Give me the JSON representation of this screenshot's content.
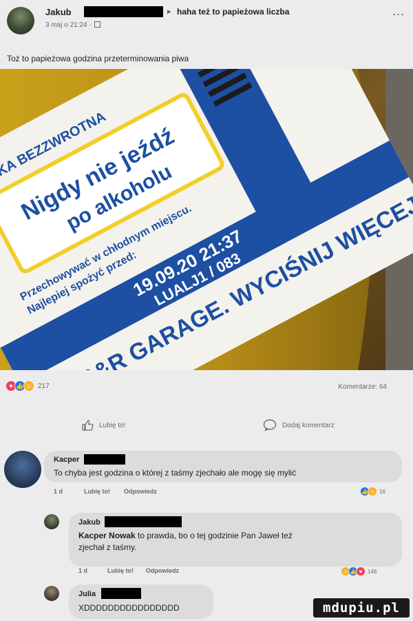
{
  "post": {
    "author": "Jakub",
    "arrow": "▸",
    "group": "haha też to papieżowa liczba",
    "more": "...",
    "date": "3 maj o 21:24 ·",
    "text": "Toż to papieżowa godzina przeterminowania piwa"
  },
  "photo": {
    "label_line1": "Nigdy nie jeźdź",
    "label_line2": "po alkoholu",
    "label_top": "ELKA BEZZWROTNA",
    "store_line1": "Przechowywać w chłodnym miejscu.",
    "store_line2": "Najlepiej spożyć przed:",
    "date_line1": "19.09.20  21:37",
    "date_line2": "LUALJ1 / 083",
    "brand": "S&R GARAGE. WYCIŚNIJ WIĘCEJ"
  },
  "reactions": {
    "count": "217"
  },
  "comments_count": "Komentarze: 64",
  "actions": {
    "like": "Lubię to!",
    "comment": "Dodaj komentarz"
  },
  "comments": [
    {
      "author": "Kacper",
      "text": "To chyba jest godzina o której z taśmy zjechało ale mogę się mylić",
      "time": "1 d",
      "like": "Lubię to!",
      "reply": "Odpowiedz",
      "reaction_count": "16"
    },
    {
      "author": "Jakub",
      "mention": "Kacper Nowak",
      "text_line1": " to prawda, bo o tej godzinie Pan Jaweł też",
      "text_line2": "zjechał z taśmy.",
      "time": "1 d",
      "like": "Lubię to!",
      "reply": "Odpowiedz",
      "reaction_count": "148"
    },
    {
      "author": "Julia",
      "text": "XDDDDDDDDDDDDDDDD"
    }
  ],
  "watermark": "mdupiu.pl",
  "colors": {
    "like_blue": "#1877f2",
    "love_red": "#f33e58",
    "haha_yellow": "#f7b125",
    "label_blue": "#1d4fa3",
    "label_yellow": "#f1cf2a"
  }
}
